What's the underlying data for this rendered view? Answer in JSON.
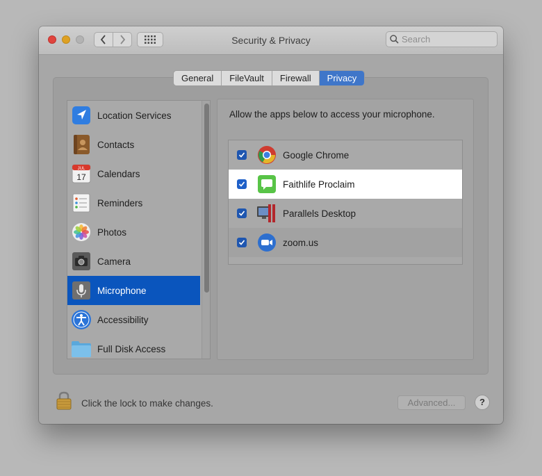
{
  "window": {
    "title": "Security & Privacy",
    "search_placeholder": "Search"
  },
  "tabs": [
    {
      "label": "General",
      "active": false
    },
    {
      "label": "FileVault",
      "active": false
    },
    {
      "label": "Firewall",
      "active": false
    },
    {
      "label": "Privacy",
      "active": true
    }
  ],
  "sidebar": {
    "items": [
      {
        "label": "Location Services",
        "icon": "location-arrow-icon"
      },
      {
        "label": "Contacts",
        "icon": "contacts-book-icon"
      },
      {
        "label": "Calendars",
        "icon": "calendar-icon",
        "icon_text_month": "JUL",
        "icon_text_day": "17"
      },
      {
        "label": "Reminders",
        "icon": "reminders-list-icon"
      },
      {
        "label": "Photos",
        "icon": "photos-flower-icon"
      },
      {
        "label": "Camera",
        "icon": "camera-icon"
      },
      {
        "label": "Microphone",
        "icon": "microphone-icon",
        "selected": true
      },
      {
        "label": "Accessibility",
        "icon": "accessibility-person-icon"
      },
      {
        "label": "Full Disk Access",
        "icon": "folder-icon"
      }
    ]
  },
  "main": {
    "prompt": "Allow the apps below to access your microphone.",
    "apps": [
      {
        "name": "Google Chrome",
        "checked": true,
        "icon": "chrome-icon"
      },
      {
        "name": "Faithlife Proclaim",
        "checked": true,
        "icon": "message-bubble-icon",
        "highlighted": true
      },
      {
        "name": "Parallels Desktop",
        "checked": true,
        "icon": "parallels-icon"
      },
      {
        "name": "zoom.us",
        "checked": true,
        "icon": "zoom-camera-icon"
      }
    ]
  },
  "footer": {
    "lock_text": "Click the lock to make changes.",
    "advanced_label": "Advanced...",
    "help_label": "?"
  },
  "colors": {
    "selection": "#0a55bd",
    "tab_active": "#3f76c9",
    "checkbox": "#1f60c8"
  }
}
